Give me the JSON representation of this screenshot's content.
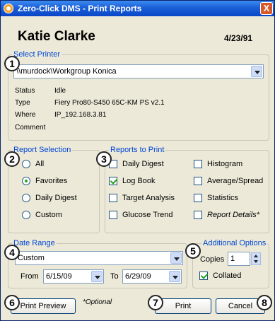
{
  "window": {
    "title": "Zero-Click DMS - Print Reports",
    "close_glyph": "X"
  },
  "patient": {
    "name": "Katie Clarke",
    "date": "4/23/91"
  },
  "select_printer": {
    "legend": "Select Printer",
    "printer_value": "\\\\murdock\\Workgroup Konica",
    "info": [
      {
        "label": "Status",
        "value": "Idle"
      },
      {
        "label": "Type",
        "value": "Fiery Pro80-S450 65C-KM PS v2.1"
      },
      {
        "label": "Where",
        "value": "IP_192.168.3.81"
      },
      {
        "label": "Comment",
        "value": ""
      }
    ]
  },
  "report_selection": {
    "legend": "Report Selection",
    "options": [
      {
        "label": "All",
        "selected": false
      },
      {
        "label": "Favorites",
        "selected": true
      },
      {
        "label": "Daily Digest",
        "selected": false
      },
      {
        "label": "Custom",
        "selected": false
      }
    ]
  },
  "reports_to_print": {
    "legend": "Reports to Print",
    "left": [
      {
        "label": "Daily Digest",
        "checked": false
      },
      {
        "label": "Log Book",
        "checked": true
      },
      {
        "label": "Target Analysis",
        "checked": false
      },
      {
        "label": "Glucose Trend",
        "checked": false
      }
    ],
    "right": [
      {
        "label": "Histogram",
        "checked": false
      },
      {
        "label": "Average/Spread",
        "checked": false
      },
      {
        "label": "Statistics",
        "checked": false
      },
      {
        "label": "Report Details*",
        "checked": false
      }
    ]
  },
  "date_range": {
    "legend": "Date Range",
    "range_value": "Custom",
    "from_label": "From",
    "from_value": "6/15/09",
    "to_label": "To",
    "to_value": "6/29/09"
  },
  "additional_options": {
    "legend": "Additional Options",
    "copies_label": "Copies",
    "copies_value": "1",
    "collated_label": "Collated",
    "collated_checked": true
  },
  "buttons": {
    "print_preview": "Print Preview",
    "optional_note": "*Optional",
    "print": "Print",
    "cancel": "Cancel"
  },
  "callouts": [
    "1",
    "2",
    "3",
    "4",
    "5",
    "6",
    "7",
    "8"
  ]
}
